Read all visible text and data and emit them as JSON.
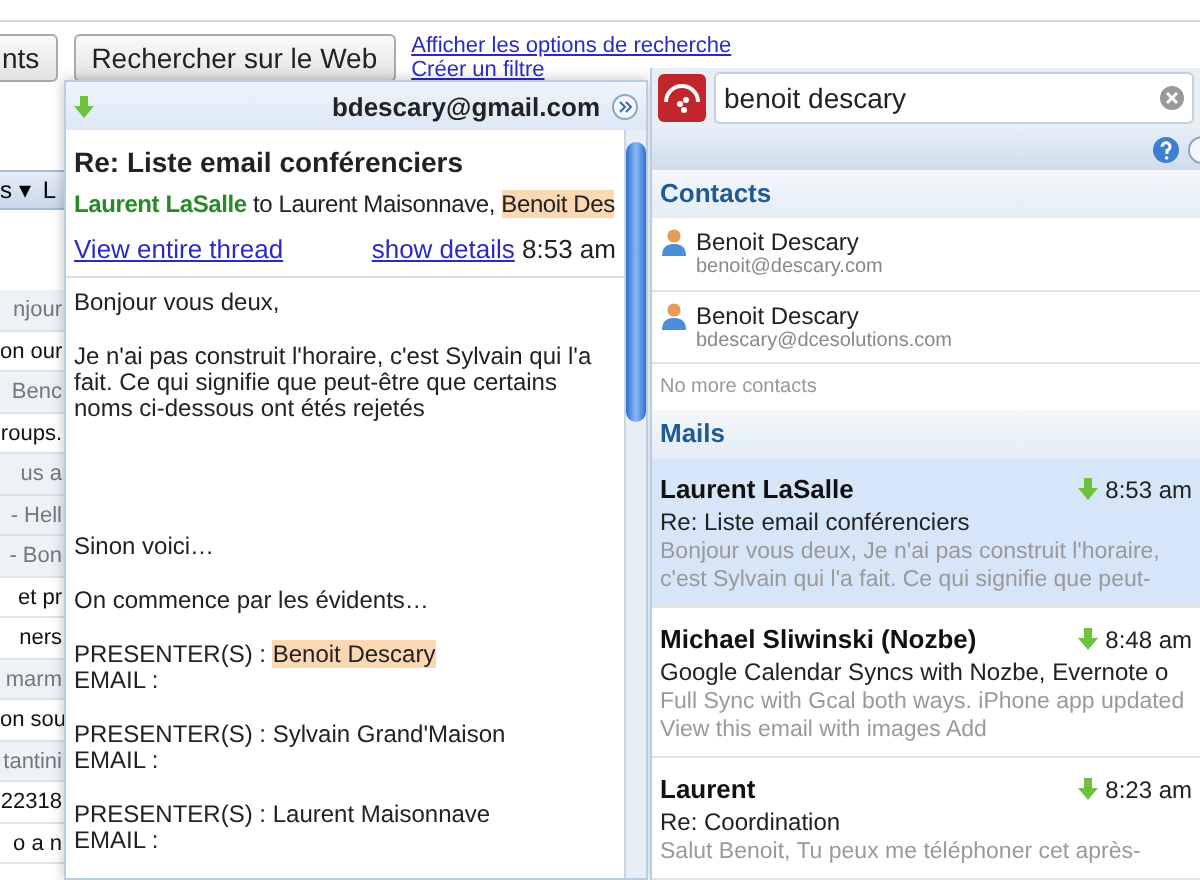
{
  "top_bar": {
    "buttons": [
      {
        "label": "nts"
      },
      {
        "label": "Rechercher sur le Web"
      }
    ],
    "links": [
      "Afficher les options de recherche",
      "Créer un filtre"
    ]
  },
  "background_list": {
    "toolbar": [
      "s ▾",
      "L"
    ],
    "rows": [
      {
        "text": "njour",
        "read": true
      },
      {
        "text": "on our",
        "read": false
      },
      {
        "text": "Benc",
        "read": true
      },
      {
        "text": "roups.",
        "read": false
      },
      {
        "text": "us a",
        "read": true
      },
      {
        "text": "- Hell",
        "read": true
      },
      {
        "text": "- Bon",
        "read": true
      },
      {
        "text": "et pr",
        "read": false
      },
      {
        "text": "ners",
        "read": false
      },
      {
        "text": "marm",
        "read": true
      },
      {
        "text": "on sou",
        "read": false
      },
      {
        "text": "tantini",
        "read": true
      },
      {
        "text": "22318",
        "read": false
      },
      {
        "text": "o a n",
        "read": false
      }
    ]
  },
  "preview": {
    "account": "bdescary@gmail.com",
    "subject": "Re: Liste email conférenciers",
    "from": "Laurent LaSalle",
    "to_parts": [
      {
        "text": " to Laurent Maisonnave, ",
        "highlight": false
      },
      {
        "text": "Benoit Des",
        "highlight": true
      }
    ],
    "thread_link": "View entire thread",
    "details_link": "show details",
    "time": "8:53 am",
    "body": [
      {
        "kind": "line",
        "parts": [
          {
            "text": "Bonjour vous deux,",
            "highlight": false
          }
        ]
      },
      {
        "kind": "paragraph",
        "parts": [
          {
            "text": "Je n'ai pas construit l'horaire, c'est Sylvain qui l'a fait. Ce qui signifie que peut-être que certains noms ci-dessous ont étés rejetés",
            "highlight": false
          }
        ]
      },
      {
        "kind": "section",
        "parts": [
          {
            "text": "Sinon voici…",
            "highlight": false
          }
        ]
      },
      {
        "kind": "paragraph",
        "parts": [
          {
            "text": "On commence par les évidents…",
            "highlight": false
          }
        ]
      },
      {
        "kind": "paragraph",
        "parts": [
          {
            "text": "PRESENTER(S) : ",
            "highlight": false
          },
          {
            "text": "Benoit Descary",
            "highlight": true
          }
        ]
      },
      {
        "kind": "line",
        "parts": [
          {
            "text": "EMAIL :",
            "highlight": false
          }
        ]
      },
      {
        "kind": "paragraph",
        "parts": [
          {
            "text": "PRESENTER(S) : Sylvain Grand'Maison",
            "highlight": false
          }
        ]
      },
      {
        "kind": "line",
        "parts": [
          {
            "text": "EMAIL :",
            "highlight": false
          }
        ]
      },
      {
        "kind": "paragraph",
        "parts": [
          {
            "text": "PRESENTER(S) : Laurent Maisonnave",
            "highlight": false
          }
        ]
      },
      {
        "kind": "line",
        "parts": [
          {
            "text": "EMAIL :",
            "highlight": false
          }
        ]
      }
    ]
  },
  "search_panel": {
    "query": "benoit descary",
    "contacts_title": "Contacts",
    "contacts": [
      {
        "name": "Benoit Descary",
        "email": "benoit@descary.com"
      },
      {
        "name": "Benoit Descary",
        "email": "bdescary@dcesolutions.com"
      }
    ],
    "no_more": "No more contacts",
    "mails_title": "Mails",
    "mails": [
      {
        "sender": "Laurent LaSalle",
        "time": "8:53 am",
        "subject": "Re: Liste email conférenciers",
        "snippet": "Bonjour vous deux,   Je n'ai pas construit l'horaire, c'est Sylvain qui l'a fait. Ce qui signifie que peut-",
        "selected": true
      },
      {
        "sender": "Michael Sliwinski (Nozbe)",
        "time": "8:48 am",
        "subject": "Google Calendar Syncs with Nozbe, Evernote o",
        "snippet": "Full Sync with Gcal both ways. iPhone app updated View this email with images Add",
        "selected": false
      },
      {
        "sender": "Laurent",
        "time": "8:23 am",
        "subject": "Re: Coordination",
        "snippet": "Salut Benoit, Tu peux me téléphoner cet après-",
        "selected": false
      }
    ]
  }
}
